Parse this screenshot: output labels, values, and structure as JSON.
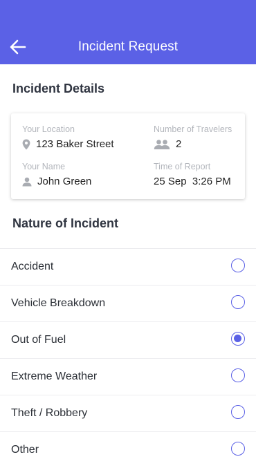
{
  "header": {
    "title": "Incident Request",
    "back_icon": "back-arrow-icon"
  },
  "details": {
    "title": "Incident Details",
    "location_label": "Your Location",
    "location_value": "123 Baker Street",
    "travelers_label": "Number of Travelers",
    "travelers_value": "2",
    "name_label": "Your Name",
    "name_value": "John Green",
    "time_label": "Time of Report",
    "time_value": "25 Sep  3:26 PM"
  },
  "nature": {
    "title": "Nature of Incident",
    "options": [
      {
        "label": "Accident",
        "selected": false
      },
      {
        "label": "Vehicle Breakdown",
        "selected": false
      },
      {
        "label": "Out of Fuel",
        "selected": true
      },
      {
        "label": "Extreme Weather",
        "selected": false
      },
      {
        "label": "Theft / Robbery",
        "selected": false
      },
      {
        "label": "Other",
        "selected": false
      }
    ]
  },
  "colors": {
    "accent": "#5b61e6",
    "label": "#b3b6bc"
  }
}
